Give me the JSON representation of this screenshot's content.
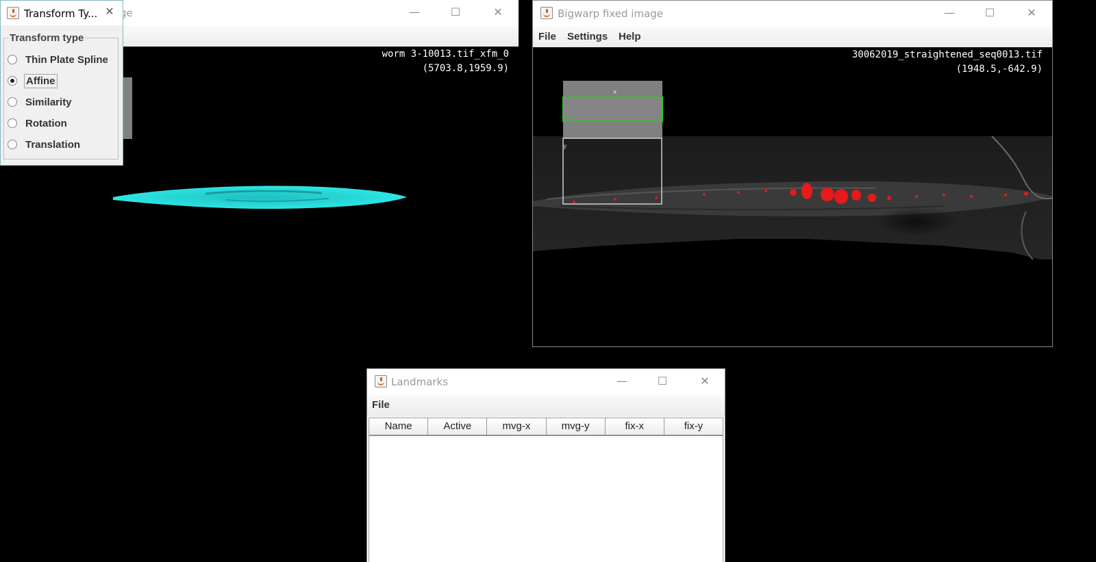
{
  "moving_window": {
    "title": "Bigwarp moving image",
    "title_visible_fragment": "ge",
    "controls": {
      "minimize": "—",
      "maximize": "☐",
      "close": "✕"
    },
    "overlay": {
      "filename": "worm 3-10013.tif_xfm_0",
      "coords": "(5703.8,1959.9)"
    }
  },
  "fixed_window": {
    "title": "Bigwarp fixed image",
    "menu": [
      "File",
      "Settings",
      "Help"
    ],
    "controls": {
      "minimize": "—",
      "maximize": "☐",
      "close": "✕"
    },
    "overlay": {
      "filename": "30062019_straightened_seq0013.tif",
      "coords": "(1948.5,-642.9)"
    },
    "axes": {
      "x": "x",
      "y": "y"
    }
  },
  "transform_dialog": {
    "title": "Transform Ty...",
    "close": "✕",
    "group_label": "Transform type",
    "options": [
      {
        "label": "Thin Plate Spline",
        "selected": false
      },
      {
        "label": "Affine",
        "selected": true
      },
      {
        "label": "Similarity",
        "selected": false
      },
      {
        "label": "Rotation",
        "selected": false
      },
      {
        "label": "Translation",
        "selected": false
      }
    ]
  },
  "landmarks_window": {
    "title": "Landmarks",
    "menu": [
      "File"
    ],
    "controls": {
      "minimize": "—",
      "maximize": "☐",
      "close": "✕"
    },
    "columns": [
      "Name",
      "Active",
      "mvg-x",
      "mvg-y",
      "fix-x",
      "fix-y"
    ],
    "rows": []
  },
  "colors": {
    "moving_channel": "#2ee6e6",
    "fixed_channel": "#e61a1a",
    "selection_box": "#22cc22"
  }
}
